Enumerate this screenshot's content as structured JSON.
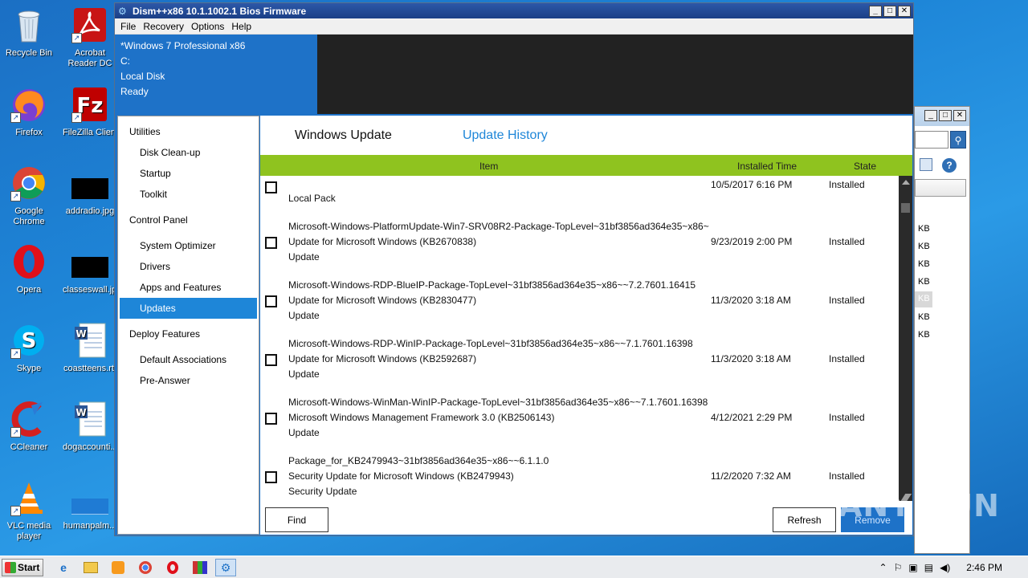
{
  "desktop": {
    "icons": [
      {
        "label": "Recycle Bin"
      },
      {
        "label": "Acrobat Reader DC"
      },
      {
        "label": "Firefox"
      },
      {
        "label": "FileZilla Client"
      },
      {
        "label": "Google Chrome"
      },
      {
        "label": "addradio.jpg"
      },
      {
        "label": "Opera"
      },
      {
        "label": "classeswall.jpg"
      },
      {
        "label": "Skype"
      },
      {
        "label": "coastteens.rtf"
      },
      {
        "label": "CCleaner"
      },
      {
        "label": "dogaccounti..."
      },
      {
        "label": "VLC media player"
      },
      {
        "label": "humanpalm..."
      }
    ]
  },
  "window": {
    "title": "Dism++x86 10.1.1002.1 Bios Firmware",
    "controls": {
      "minimize": "_",
      "maximize": "□",
      "close": "✕"
    },
    "menu": [
      "File",
      "Recovery",
      "Options",
      "Help"
    ],
    "info": {
      "os": "*Windows 7 Professional x86",
      "drive": "C:",
      "disk": "Local Disk",
      "status": "Ready"
    }
  },
  "sidebar": {
    "sections": [
      {
        "title": "Utilities",
        "items": [
          "Disk Clean-up",
          "Startup",
          "Toolkit"
        ]
      },
      {
        "title": "Control Panel",
        "items": [
          "System Optimizer",
          "Drivers",
          "Apps and Features",
          "Updates"
        ]
      },
      {
        "title": "Deploy Features",
        "items": [
          "Default Associations",
          "Pre-Answer"
        ]
      }
    ],
    "active": "Updates"
  },
  "content": {
    "tabs": [
      "Windows Update",
      "Update History"
    ],
    "columns": {
      "item": "Item",
      "installed_time": "Installed Time",
      "state": "State"
    },
    "rows": [
      {
        "lines": [
          "Local Pack"
        ],
        "time": "10/5/2017 6:16 PM",
        "state": "Installed"
      },
      {
        "lines": [
          "Microsoft-Windows-PlatformUpdate-Win7-SRV08R2-Package-TopLevel~31bf3856ad364e35~x86~",
          "Update for Microsoft Windows (KB2670838)",
          "Update"
        ],
        "time": "9/23/2019 2:00 PM",
        "state": "Installed"
      },
      {
        "lines": [
          "Microsoft-Windows-RDP-BlueIP-Package-TopLevel~31bf3856ad364e35~x86~~7.2.7601.16415",
          "Update for Microsoft Windows (KB2830477)",
          "Update"
        ],
        "time": "11/3/2020 3:18 AM",
        "state": "Installed"
      },
      {
        "lines": [
          "Microsoft-Windows-RDP-WinIP-Package-TopLevel~31bf3856ad364e35~x86~~7.1.7601.16398",
          "Update for Microsoft Windows (KB2592687)",
          "Update"
        ],
        "time": "11/3/2020 3:18 AM",
        "state": "Installed"
      },
      {
        "lines": [
          "Microsoft-Windows-WinMan-WinIP-Package-TopLevel~31bf3856ad364e35~x86~~7.1.7601.16398",
          "Microsoft Windows Management Framework 3.0 (KB2506143)",
          "Update"
        ],
        "time": "4/12/2021 2:29 PM",
        "state": "Installed"
      },
      {
        "lines": [
          "Package_for_KB2479943~31bf3856ad364e35~x86~~6.1.1.0",
          "Security Update for Microsoft Windows (KB2479943)",
          "Security Update"
        ],
        "time": "11/2/2020 7:32 AM",
        "state": "Installed"
      }
    ],
    "buttons": {
      "find": "Find",
      "refresh": "Refresh",
      "remove": "Remove"
    }
  },
  "bg_window": {
    "sizes": [
      "KB",
      "KB",
      "KB",
      "KB",
      "KB",
      "KB",
      "KB"
    ]
  },
  "taskbar": {
    "start": "Start",
    "clock": "2:46 PM"
  },
  "watermark": "ANY RUN"
}
